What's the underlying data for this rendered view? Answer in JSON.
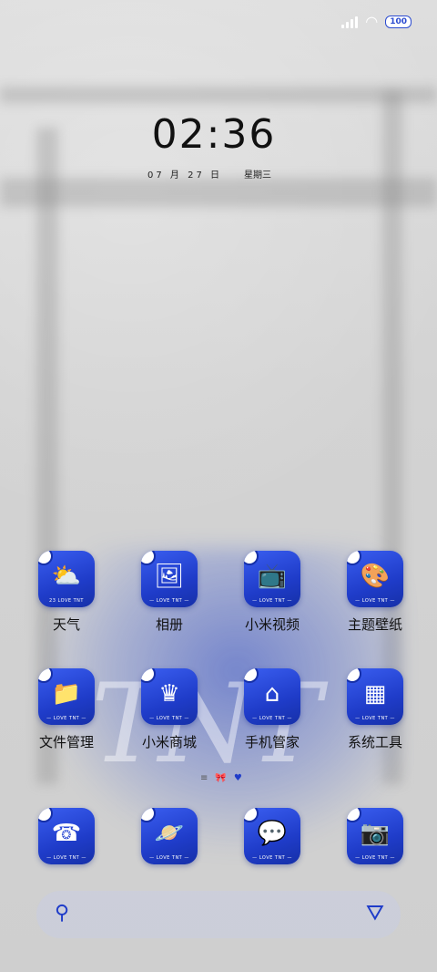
{
  "status_bar": {
    "battery": "100",
    "signal_icon": "signal-icon",
    "wifi_icon": "wifi-icon"
  },
  "clock": {
    "time": "02:36",
    "date": "07 月 27 日",
    "weekday": "星期三"
  },
  "apps": [
    {
      "label": "天气",
      "icon": "weather-icon",
      "glyph": "⛅",
      "tag": "23 LOVE TNT"
    },
    {
      "label": "相册",
      "icon": "gallery-icon",
      "glyph": "🖼",
      "tag": "— LOVE TNT —"
    },
    {
      "label": "小米视频",
      "icon": "tv-icon",
      "glyph": "📺",
      "tag": "— LOVE TNT —"
    },
    {
      "label": "主题壁纸",
      "icon": "palette-icon",
      "glyph": "🎨",
      "tag": "— LOVE TNT —"
    },
    {
      "label": "文件管理",
      "icon": "folder-icon",
      "glyph": "📁",
      "tag": "— LOVE TNT —"
    },
    {
      "label": "小米商城",
      "icon": "crown-icon",
      "glyph": "♛",
      "tag": "— LOVE TNT —"
    },
    {
      "label": "手机管家",
      "icon": "shield-icon",
      "glyph": "⌂",
      "tag": "— LOVE TNT —"
    },
    {
      "label": "系统工具",
      "icon": "toolbox-icon",
      "glyph": "▦",
      "tag": "— LOVE TNT —"
    },
    {
      "label": "",
      "icon": "phone-icon",
      "glyph": "☎",
      "tag": "— LOVE TNT —"
    },
    {
      "label": "",
      "icon": "browser-icon",
      "glyph": "🪐",
      "tag": "— LOVE TNT —"
    },
    {
      "label": "",
      "icon": "messages-icon",
      "glyph": "💬",
      "tag": "— LOVE TNT —"
    },
    {
      "label": "",
      "icon": "camera-icon",
      "glyph": "📷",
      "tag": "— LOVE TNT —"
    }
  ],
  "wallpaper": {
    "text": "TNT"
  },
  "page_indicator": {
    "left": "≡",
    "middle": "🎀",
    "right": "♥"
  },
  "dock": {
    "search_icon": "search-icon",
    "assistant_icon": "assistant-icon"
  }
}
